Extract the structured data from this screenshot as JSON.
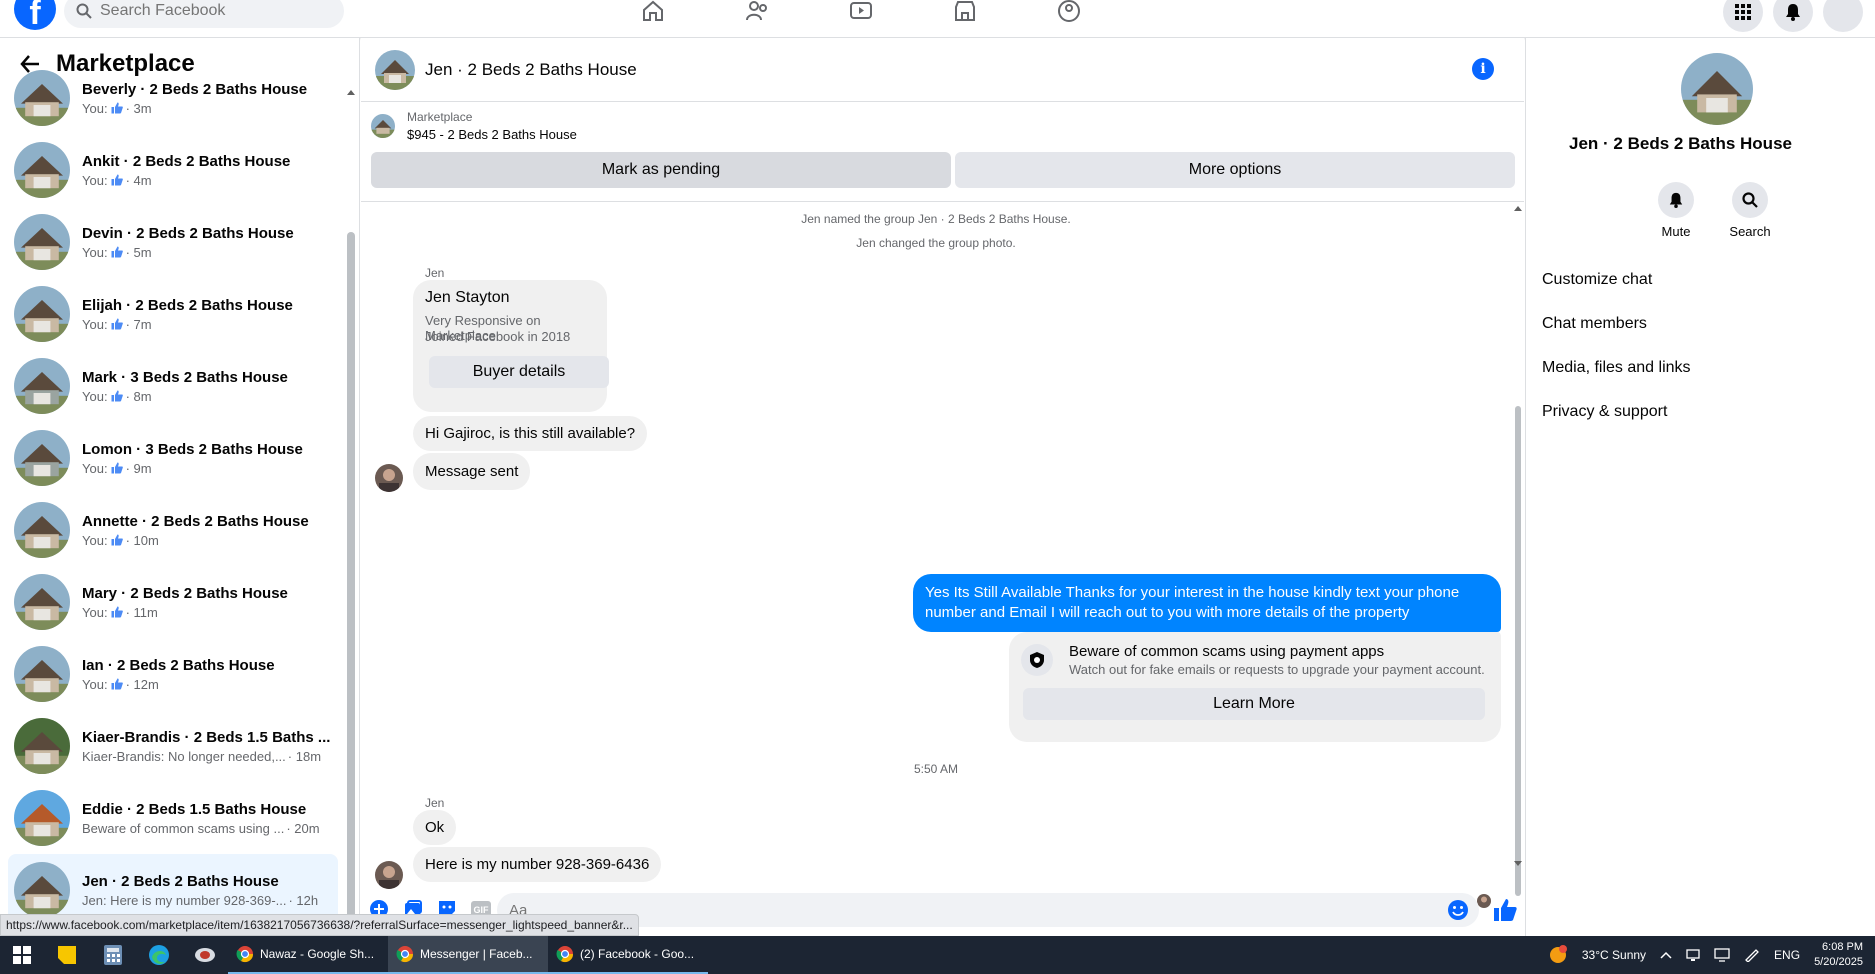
{
  "top_nav": {
    "search_placeholder": "Search Facebook",
    "icons": [
      "home-icon",
      "friends-icon",
      "watch-icon",
      "marketplace-icon",
      "groups-icon"
    ],
    "right_icons": [
      "menu-grid-icon",
      "notifications-icon",
      "profile-icon"
    ]
  },
  "sidebar": {
    "title": "Marketplace",
    "conversations": [
      {
        "name": "Beverly · 2 Beds 2 Baths House",
        "preview": "You:",
        "time": "· 3m",
        "liked": true
      },
      {
        "name": "Ankit · 2 Beds 2 Baths House",
        "preview": "You:",
        "time": "· 4m",
        "liked": true
      },
      {
        "name": "Devin · 2 Beds 2 Baths House",
        "preview": "You:",
        "time": "· 5m",
        "liked": true
      },
      {
        "name": "Elijah · 2 Beds 2 Baths House",
        "preview": "You:",
        "time": "· 7m",
        "liked": true
      },
      {
        "name": "Mark · 3 Beds 2 Baths House",
        "preview": "You:",
        "time": "· 8m",
        "liked": true
      },
      {
        "name": "Lomon · 3 Beds 2 Baths House",
        "preview": "You:",
        "time": "· 9m",
        "liked": true
      },
      {
        "name": "Annette · 2 Beds 2 Baths House",
        "preview": "You:",
        "time": "· 10m",
        "liked": true
      },
      {
        "name": "Mary · 2 Beds 2 Baths House",
        "preview": "You:",
        "time": "· 11m",
        "liked": true
      },
      {
        "name": "Ian · 2 Beds 2 Baths House",
        "preview": "You:",
        "time": "· 12m",
        "liked": true
      },
      {
        "name": "Kiaer-Brandis · 2 Beds 1.5 Baths ...",
        "preview": "Kiaer-Brandis: No longer needed,...",
        "time": "· 18m",
        "liked": false
      },
      {
        "name": "Eddie · 2 Beds 1.5 Baths House",
        "preview": "Beware of common scams using ...",
        "time": "· 20m",
        "liked": false
      },
      {
        "name": "Jen · 2 Beds 2 Baths House",
        "preview": "Jen: Here is my number 928-369-...",
        "time": "· 12h",
        "liked": false,
        "active": true
      }
    ]
  },
  "chat": {
    "title": "Jen · 2 Beds 2 Baths House",
    "listing_label": "Marketplace",
    "listing_price": "$945 - 2 Beds 2 Baths House",
    "mark_pending": "Mark as pending",
    "more_options": "More options",
    "sys_named": "Jen named the group Jen · 2 Beds 2 Baths House.",
    "sys_photo": "Jen changed the group photo.",
    "sender_1": "Jen",
    "profile_card": {
      "name": "Jen Stayton",
      "line1": "Very Responsive on Marketplace",
      "line2": "Joined Facebook in 2018",
      "button": "Buyer details"
    },
    "msg_1": "Hi Gajiroc, is this still available?",
    "msg_2": "Message sent",
    "my_msg": "Yes Its Still Available Thanks for your interest in the house kindly text your phone number and Email I will reach out to you with more details of the property",
    "scam_card": {
      "title": "Beware of common scams using payment apps",
      "body": "Watch out for fake emails or requests to upgrade your payment account.",
      "button": "Learn More"
    },
    "timestamp": "5:50 AM",
    "sender_2": "Jen",
    "msg_3": "Ok",
    "msg_4": "Here is my number 928-369-6436",
    "composer_placeholder": "Aa"
  },
  "details": {
    "title": "Jen · 2 Beds 2 Baths House",
    "mute": "Mute",
    "search": "Search",
    "menu": [
      "Customize chat",
      "Chat members",
      "Media, files and links",
      "Privacy & support"
    ]
  },
  "status_url": "https://www.facebook.com/marketplace/item/1638217056736638/?referralSurface=messenger_lightspeed_banner&r...",
  "taskbar": {
    "windows": [
      "Nawaz - Google Sh...",
      "Messenger | Faceb...",
      "(2) Facebook - Goo..."
    ],
    "weather": "33°C  Sunny",
    "lang": "ENG",
    "time": "6:08 PM",
    "date": "5/20/2025"
  },
  "colors": {
    "brand": "#0866ff",
    "my_bubble": "#0084ff",
    "bubble_gray": "#f0f0f0",
    "active_row": "#ebf5ff"
  }
}
